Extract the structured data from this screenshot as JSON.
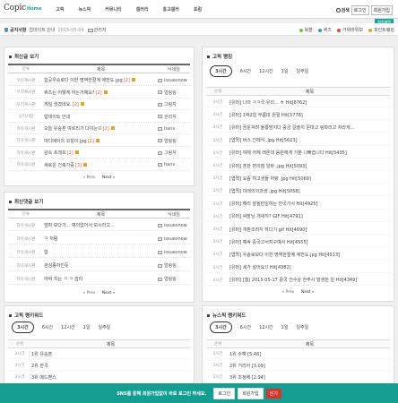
{
  "header": {
    "logo": "Copic",
    "nav": [
      "Home",
      "고픽",
      "뉴스픽",
      "커뮤니티",
      "갤러리",
      "홍고갤러",
      "포럼"
    ],
    "search": "검색",
    "login": "로그인",
    "signup": "회원가입",
    "welcome": "회원혜택"
  },
  "notice": {
    "label": "공지사항",
    "title": "업데이트 안내",
    "date": "2015-05-09",
    "author": "관리자",
    "links": [
      "북판",
      "퀴즈",
      "가위바위보",
      "포인트랭킹"
    ]
  },
  "latest": {
    "title": "최신글 보기",
    "columns": [
      "분류",
      "제목",
      "닉네임"
    ],
    "rows": [
      {
        "cat": "우리계시판",
        "title": "힙곳우승로다 이한 명역한절계 애전도.jpg",
        "count": "[2]",
        "writer": "issuesnow"
      },
      {
        "cat": "우리계시판",
        "title": "퀴즈는 어떻게 하는거예요?",
        "count": "[2]",
        "writer": "얼링링"
      },
      {
        "cat": "우리계시판",
        "title": "게임 생겼네요.",
        "count": "[2]",
        "writer": "그림자"
      },
      {
        "cat": "공지사항",
        "title": "업데이트 안내",
        "count": "",
        "writer": "관리자"
      },
      {
        "cat": "자유게시판",
        "title": "오늘 유승훈 여르리기 다이는ㅁ",
        "count": "[2]",
        "writer": "hanv"
      },
      {
        "cat": "자유게시판",
        "title": "마디에이의 코칭이.jpg",
        "count": "[2]",
        "writer": "얼링링"
      },
      {
        "cat": "자유게시판",
        "title": "강속 프레프",
        "count": "[2]",
        "writer": "그림자"
      },
      {
        "cat": "자유게시판",
        "title": "새로운 건축가증",
        "count": "[3]",
        "writer": "hanv"
      }
    ],
    "pager": {
      "prev": "« Prev",
      "next": "Next »"
    }
  },
  "comments": {
    "title": "최신댓글 보기",
    "columns": [
      "분류",
      "제목",
      "닉네임"
    ],
    "rows": [
      {
        "cat": "자유게시판",
        "title": "엄퍼 보다가... 여의없어서 보시라고...",
        "writer": "issuesnow"
      },
      {
        "cat": "자유게시판",
        "title": "ㅋ 처럼",
        "writer": "issuesnow"
      },
      {
        "cat": "자유게시판",
        "title": "함",
        "writer": "issuesnow"
      },
      {
        "cat": "자유게시판",
        "title": "관심종자인듯",
        "writer": "얼링링"
      },
      {
        "cat": "자유게시판",
        "title": "아싸 치는 ㅋ ㅋ 습리",
        "writer": "얼링링"
      }
    ],
    "pager": {
      "prev": "« Prev",
      "next": "Next »"
    }
  },
  "postRank": {
    "title": "고픽 랭킹",
    "tabs": [
      "3시간",
      "6시간",
      "12시간",
      "1일",
      "일주일"
    ],
    "columns": [
      "순위",
      "제목"
    ],
    "rows": [
      {
        "time": "3시간",
        "title": "[유머] 나의 ㅋㅋ국 유리... ㅎ Hit[8762]"
      },
      {
        "time": "3시간",
        "title": "[유머] 1박2일 부름대 원릴 Hit[5778]"
      },
      {
        "time": "3시간",
        "title": "[유머] 곰운겨려 울릉밤지다 증궁 갈솔치 문대고 링파리고 자라게..."
      },
      {
        "time": "3시간",
        "title": "[엽퀵] 버스 인례식 .jpg Hit[5623]"
      },
      {
        "time": "3시간",
        "title": "[유머] 여체 어체 래온대 음원에게 기분 나빠습니다 Hit[5435]"
      },
      {
        "time": "3시간",
        "title": "[유머] 훈한 편의점 알바 .jpg Hit[5093]"
      },
      {
        "time": "3시간",
        "title": "[엽퀵] 요즘 여고생들 처량 .jpg Hit[5069]"
      },
      {
        "time": "3시간",
        "title": "[엽퀵] 미래의의과생 .jpg Hit[5058]"
      },
      {
        "time": "3시간",
        "title": "[유머] 해리 잘될만일하는 한국가사 Hit[4925]"
      },
      {
        "time": "3시간",
        "title": "[유머] 싸장님 개새끼? GIF Hit[4791]"
      },
      {
        "time": "3시간",
        "title": "[유머] 개판조려지 하디기.gif Hit[4690]"
      },
      {
        "time": "3시간",
        "title": "[유머] 예싸 중국고서지구예서 Hit[4555]"
      },
      {
        "time": "3시간",
        "title": "[엽퀵] 우승로보다 이한 명역한절계 애전도.jpg Hit[4513]"
      },
      {
        "time": "3시간",
        "title": "[유머] 세가 삼어요!! Hit[4382]"
      },
      {
        "time": "3시간",
        "title": "[유머] [웹] 2015-05-17 중국 건수상 한주사 발생한 일 Hit[4349]"
      }
    ],
    "pager": {
      "prev": "« Prev",
      "next": "Next »"
    }
  },
  "keywordRank": {
    "title": "고픽 랭키워드",
    "tabs": [
      "3시간",
      "6시간",
      "12시간",
      "1일",
      "일주일"
    ],
    "columns": [
      "순위",
      "제목"
    ],
    "rows": [
      {
        "time": "3시간",
        "title": "1위 유승훈"
      },
      {
        "time": "3시간",
        "title": "2위 한국"
      },
      {
        "time": "3시간",
        "title": "3위 메드벤스"
      }
    ]
  },
  "newsRank": {
    "title": "뉴스픽 랭키워드",
    "tabs": [
      "3시간",
      "6시간",
      "12시간",
      "1일",
      "일주일"
    ],
    "columns": [
      "순위",
      "제목"
    ],
    "rows": [
      {
        "time": "3시간",
        "title": "1위 수해 [5.46]"
      },
      {
        "time": "3시간",
        "title": "2위 거리아 [3.09]"
      },
      {
        "time": "3시간",
        "title": "3위 조정해 [2.94]"
      }
    ]
  },
  "bottomBar": {
    "message": "SNS를 통해 회원가입없이 바로 로그인 하세요.",
    "login": "로그인",
    "signup": "회원가입",
    "close": "닫기"
  },
  "colors": {
    "accent": "#15a89a",
    "bar": "#149e91",
    "close": "#d9342b",
    "count": "#e65b2a"
  }
}
